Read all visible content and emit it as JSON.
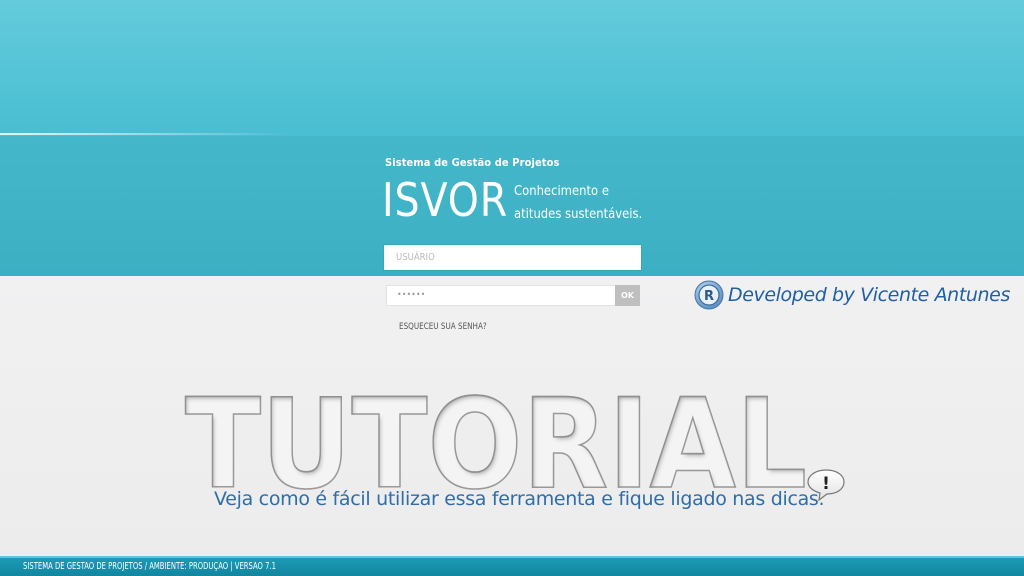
{
  "brand": {
    "subtitle": "Sistema de Gestão de Projetos",
    "name": "ISVOR",
    "tagline_line1": "Conhecimento e",
    "tagline_line2": "atitudes sustentáveis."
  },
  "login": {
    "username_placeholder": "USUÁRIO",
    "password_value": "••••••",
    "ok_label": "OK",
    "forgot_label": "ESQUECEU SUA SENHA?"
  },
  "developer": {
    "icon": "r-logo-icon",
    "text": "Developed by Vicente Antunes"
  },
  "tutorial": {
    "title": "TUTORIAL",
    "subtitle": "Veja como é fácil utilizar essa ferramenta e fique ligado nas dicas.",
    "bubble_icon": "exclamation-bubble-icon",
    "bubble_symbol": "!"
  },
  "footer": {
    "text": "SISTEMA DE GESTÃO DE PROJETOS /    AMBIENTE: PRODUÇÃO | VERSÃO 7.1"
  },
  "colors": {
    "teal": "#4bbfd2",
    "blue_text": "#2f6da8",
    "footer": "#1b9bb5"
  }
}
